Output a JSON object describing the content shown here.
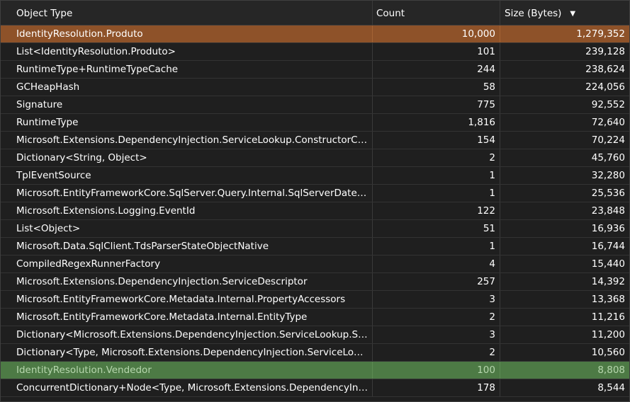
{
  "columns": {
    "type": "Object Type",
    "count": "Count",
    "size": "Size (Bytes)"
  },
  "sort": {
    "column": "size",
    "direction": "descending"
  },
  "highlight_colors": {
    "primary": "#8e5229",
    "secondary": "#4d7a45"
  },
  "rows": [
    {
      "type": "IdentityResolution.Produto",
      "count": "10,000",
      "size": "1,279,352",
      "highlight": "orange"
    },
    {
      "type": "List<IdentityResolution.Produto>",
      "count": "101",
      "size": "239,128"
    },
    {
      "type": "RuntimeType+RuntimeTypeCache",
      "count": "244",
      "size": "238,624"
    },
    {
      "type": "GCHeapHash",
      "count": "58",
      "size": "224,056"
    },
    {
      "type": "Signature",
      "count": "775",
      "size": "92,552"
    },
    {
      "type": "RuntimeType",
      "count": "1,816",
      "size": "72,640"
    },
    {
      "type": "Microsoft.Extensions.DependencyInjection.ServiceLookup.ConstructorCallSite",
      "count": "154",
      "size": "70,224"
    },
    {
      "type": "Dictionary<String, Object>",
      "count": "2",
      "size": "45,760"
    },
    {
      "type": "TplEventSource",
      "count": "1",
      "size": "32,280"
    },
    {
      "type": "Microsoft.EntityFrameworkCore.SqlServer.Query.Internal.SqlServerDateDiffFu...",
      "count": "1",
      "size": "25,536"
    },
    {
      "type": "Microsoft.Extensions.Logging.EventId",
      "count": "122",
      "size": "23,848"
    },
    {
      "type": "List<Object>",
      "count": "51",
      "size": "16,936"
    },
    {
      "type": "Microsoft.Data.SqlClient.TdsParserStateObjectNative",
      "count": "1",
      "size": "16,744"
    },
    {
      "type": "CompiledRegexRunnerFactory",
      "count": "4",
      "size": "15,440"
    },
    {
      "type": "Microsoft.Extensions.DependencyInjection.ServiceDescriptor",
      "count": "257",
      "size": "14,392"
    },
    {
      "type": "Microsoft.EntityFrameworkCore.Metadata.Internal.PropertyAccessors",
      "count": "3",
      "size": "13,368"
    },
    {
      "type": "Microsoft.EntityFrameworkCore.Metadata.Internal.EntityType",
      "count": "2",
      "size": "11,216"
    },
    {
      "type": "Dictionary<Microsoft.Extensions.DependencyInjection.ServiceLookup.Service...",
      "count": "3",
      "size": "11,200"
    },
    {
      "type": "Dictionary<Type, Microsoft.Extensions.DependencyInjection.ServiceLookup....",
      "count": "2",
      "size": "10,560"
    },
    {
      "type": "IdentityResolution.Vendedor",
      "count": "100",
      "size": "8,808",
      "highlight": "green"
    },
    {
      "type": "ConcurrentDictionary+Node<Type, Microsoft.Extensions.DependencyInjecti...",
      "count": "178",
      "size": "8,544"
    }
  ]
}
